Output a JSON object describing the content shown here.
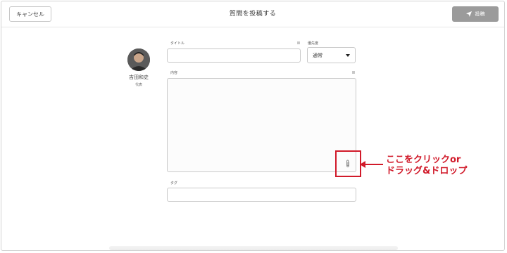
{
  "header": {
    "cancel_label": "キャンセル",
    "title": "質問を投稿する",
    "post_label": "投稿",
    "post_icon": "paper-plane-icon"
  },
  "user": {
    "name": "吉田和史",
    "role": "代表"
  },
  "form": {
    "title_label": "タイトル",
    "title_value": "",
    "priority_label": "優先度",
    "priority_value": "通常",
    "content_label": "内容",
    "content_value": "",
    "tag_label": "タグ",
    "tag_value": "",
    "attach_icon": "paperclip-icon"
  },
  "annotation": {
    "line1": "ここをクリックor",
    "line2": "ドラッグ&ドロップ",
    "color": "#d11a2a"
  }
}
